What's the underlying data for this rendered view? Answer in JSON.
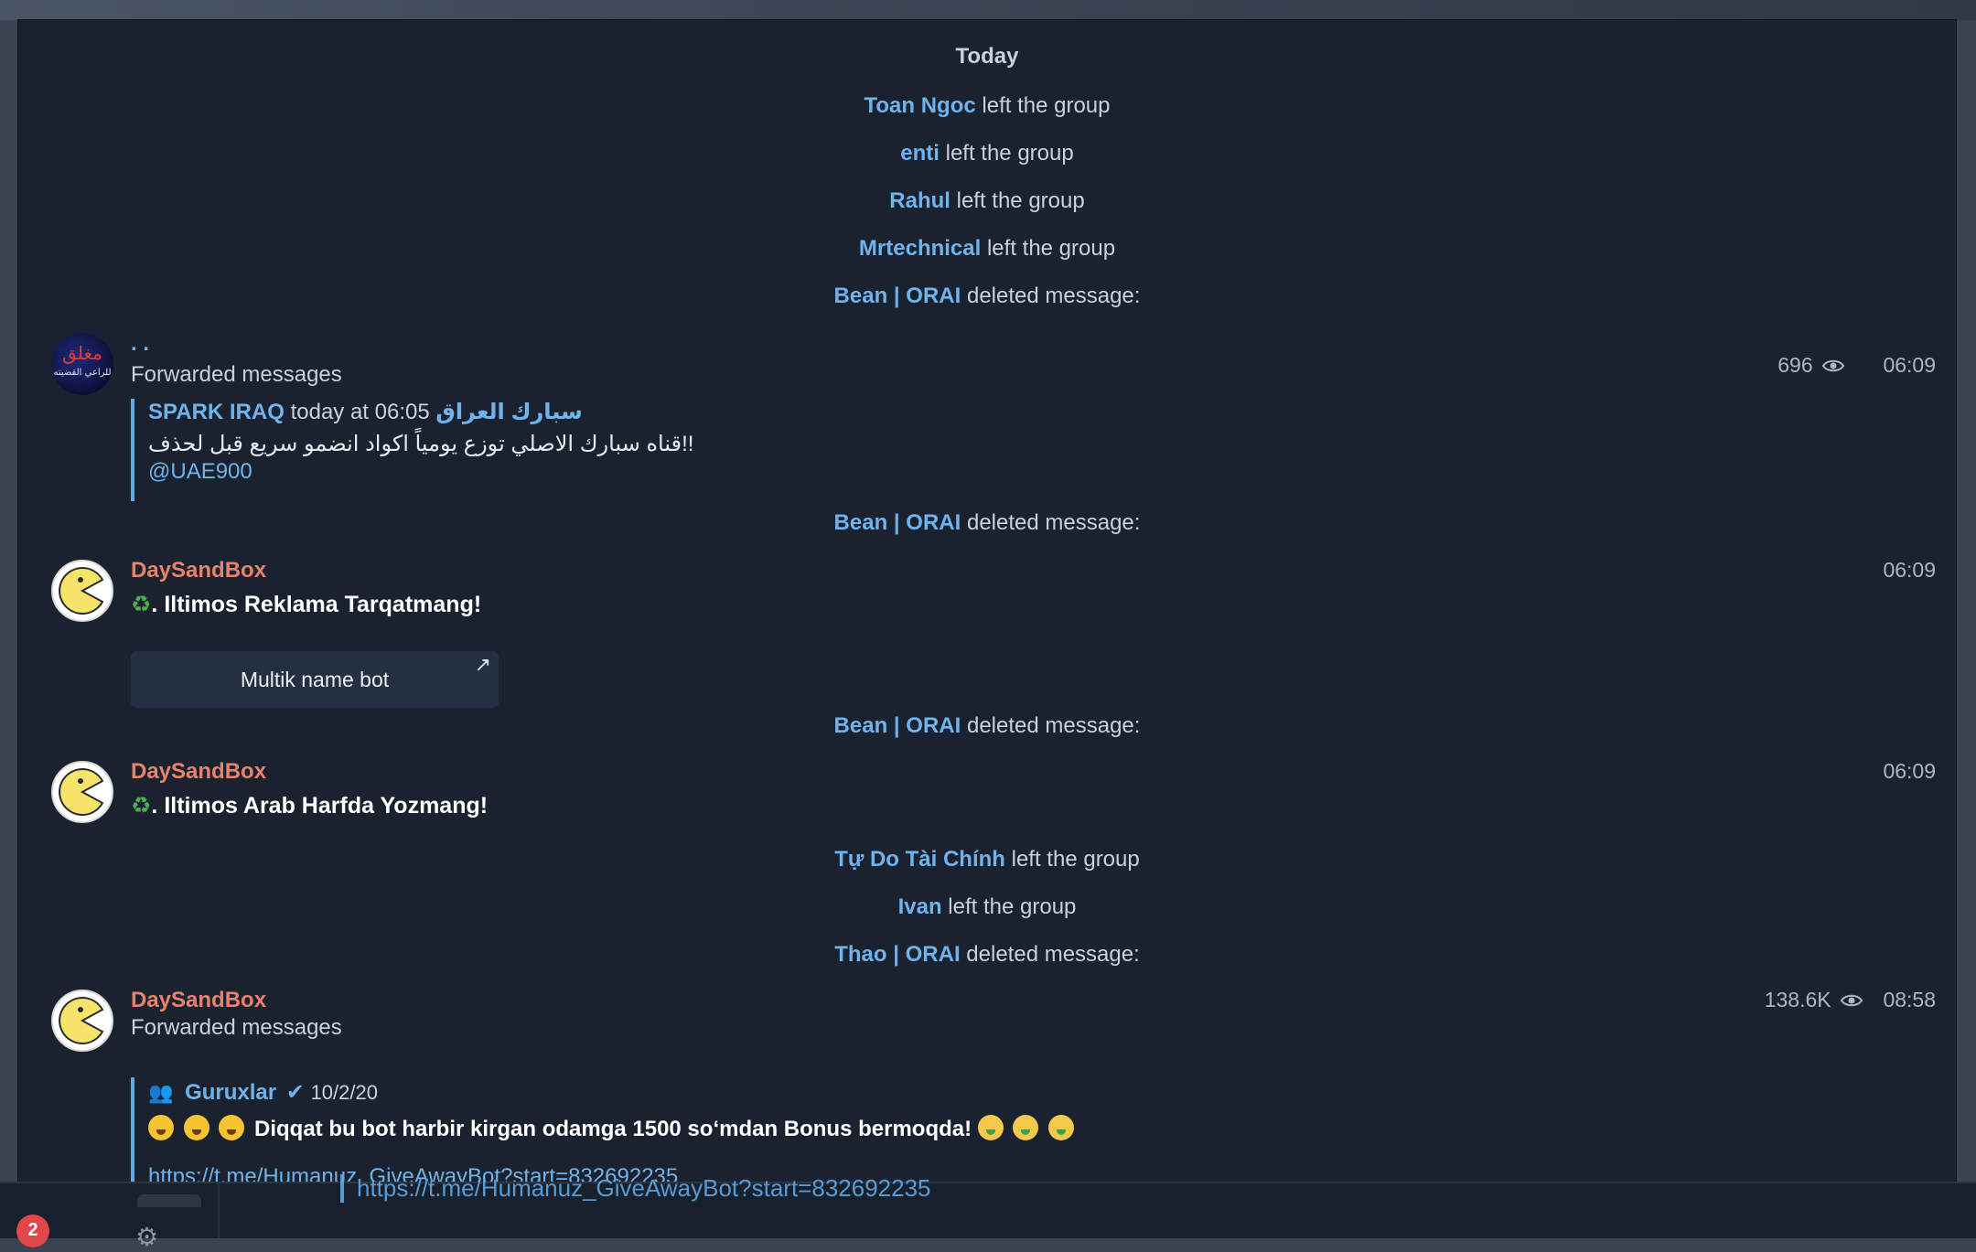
{
  "day_separator": "Today",
  "service_lines": [
    {
      "name": "Toan Ngoc",
      "action": "left the group"
    },
    {
      "name": "enti",
      "action": "left the group"
    },
    {
      "name": "Rahul",
      "action": "left the group"
    },
    {
      "name": "Mrtechnical",
      "action": "left the group"
    },
    {
      "name": "Bean | ORAI",
      "action": "deleted message:"
    },
    {
      "name": "Bean | ORAI",
      "action": "deleted message:"
    },
    {
      "name": "Bean | ORAI",
      "action": "deleted message:"
    },
    {
      "name": "Tự Do Tài Chính",
      "action": "left the group"
    },
    {
      "name": "Ivan",
      "action": "left the group"
    },
    {
      "name": "Thao | ORAI",
      "action": "deleted message:"
    }
  ],
  "messages": [
    {
      "sender": ". .",
      "avatar_text": "مغلق",
      "avatar_subtext": "للراعي القضيته",
      "forwarded_label": "Forwarded messages",
      "views": "696",
      "time": "06:09",
      "quote": {
        "author": "SPARK IRAQ",
        "when": "today at 06:05",
        "channel": "سبارك العراق",
        "text": "قناه سبارك الاصلي توزع يومياً اكواد انضمو سريع قبل لحذف!!",
        "mention": "@UAE900"
      }
    },
    {
      "sender": "DaySandBox",
      "time": "06:09",
      "text": ". Iltimos Reklama Tarqatmang!",
      "button": "Multik name bot"
    },
    {
      "sender": "DaySandBox",
      "time": "06:09",
      "text": ". Iltimos Arab Harfda  Yozmang!"
    },
    {
      "sender": "DaySandBox",
      "forwarded_label": "Forwarded messages",
      "views": "138.6K",
      "time": "08:58",
      "quote": {
        "author": "Guruxlar",
        "date": "10/2/20",
        "text": "Diqqat bu bot harbir kirgan odamga 1500 so‘mdan Bonus bermoqda!",
        "link": "https://t.me/Humanuz_GiveAwayBot?start=832692235"
      }
    }
  ],
  "underlay": {
    "link": "https://t.me/Humanuz_GiveAwayBot?start=832692235",
    "badge_count": "2"
  },
  "colors": {
    "background": "#1a2230",
    "link_blue": "#6fb3ec",
    "sender_orange": "#e8826b",
    "quote_bar": "#5da9e9",
    "badge_red": "#e0464a"
  },
  "icons": [
    "eye-icon",
    "recycle-icon",
    "pacman-avatar",
    "arrow-up-right-icon",
    "people-icon",
    "verified-check-icon",
    "scream-emoji",
    "money-face-emoji",
    "gear-icon"
  ]
}
